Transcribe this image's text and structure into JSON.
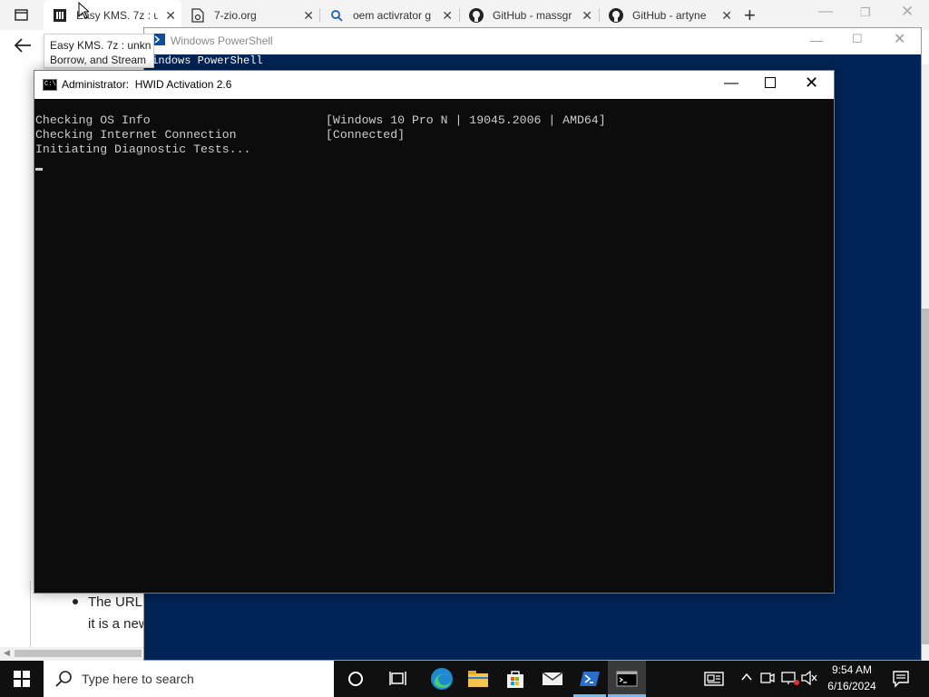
{
  "browser": {
    "tabs": [
      {
        "label": "Easy KMS. 7z : u",
        "icon": "library-icon",
        "active": true
      },
      {
        "label": "7-zio.org",
        "icon": "page-icon",
        "active": false
      },
      {
        "label": "oem activrator g",
        "icon": "search-icon",
        "active": false
      },
      {
        "label": "GitHub - massgr",
        "icon": "github-icon",
        "active": false
      },
      {
        "label": "GitHub - artyne",
        "icon": "github-icon",
        "active": false
      }
    ],
    "tooltip_line1": "Easy KMS. 7z : unkn",
    "tooltip_line2": "Borrow, and Stream",
    "page_text_line1": "The URL",
    "page_text_line2": "it is a new"
  },
  "powershell": {
    "title": "Windows PowerShell",
    "first_line": "Windows PowerShell"
  },
  "cmd": {
    "title": "Administrator:  HWID Activation 2.6",
    "lines": [
      {
        "label": "Checking OS Info",
        "value": "[Windows 10 Pro N | 19045.2006 | AMD64]"
      },
      {
        "label": "Checking Internet Connection",
        "value": "[Connected]"
      },
      {
        "label": "Initiating Diagnostic Tests...",
        "value": ""
      }
    ]
  },
  "taskbar": {
    "search_placeholder": "Type here to search",
    "time": "9:54 AM",
    "date": "6/16/2024",
    "accent": "#76b9ed"
  }
}
